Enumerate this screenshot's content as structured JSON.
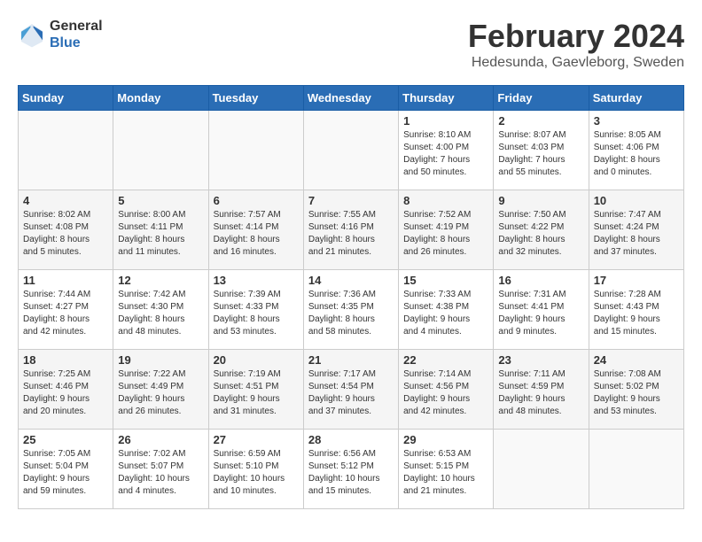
{
  "header": {
    "logo_general": "General",
    "logo_blue": "Blue",
    "title": "February 2024",
    "subtitle": "Hedesunda, Gaevleborg, Sweden"
  },
  "weekdays": [
    "Sunday",
    "Monday",
    "Tuesday",
    "Wednesday",
    "Thursday",
    "Friday",
    "Saturday"
  ],
  "weeks": [
    [
      {
        "day": "",
        "info": ""
      },
      {
        "day": "",
        "info": ""
      },
      {
        "day": "",
        "info": ""
      },
      {
        "day": "",
        "info": ""
      },
      {
        "day": "1",
        "info": "Sunrise: 8:10 AM\nSunset: 4:00 PM\nDaylight: 7 hours\nand 50 minutes."
      },
      {
        "day": "2",
        "info": "Sunrise: 8:07 AM\nSunset: 4:03 PM\nDaylight: 7 hours\nand 55 minutes."
      },
      {
        "day": "3",
        "info": "Sunrise: 8:05 AM\nSunset: 4:06 PM\nDaylight: 8 hours\nand 0 minutes."
      }
    ],
    [
      {
        "day": "4",
        "info": "Sunrise: 8:02 AM\nSunset: 4:08 PM\nDaylight: 8 hours\nand 5 minutes."
      },
      {
        "day": "5",
        "info": "Sunrise: 8:00 AM\nSunset: 4:11 PM\nDaylight: 8 hours\nand 11 minutes."
      },
      {
        "day": "6",
        "info": "Sunrise: 7:57 AM\nSunset: 4:14 PM\nDaylight: 8 hours\nand 16 minutes."
      },
      {
        "day": "7",
        "info": "Sunrise: 7:55 AM\nSunset: 4:16 PM\nDaylight: 8 hours\nand 21 minutes."
      },
      {
        "day": "8",
        "info": "Sunrise: 7:52 AM\nSunset: 4:19 PM\nDaylight: 8 hours\nand 26 minutes."
      },
      {
        "day": "9",
        "info": "Sunrise: 7:50 AM\nSunset: 4:22 PM\nDaylight: 8 hours\nand 32 minutes."
      },
      {
        "day": "10",
        "info": "Sunrise: 7:47 AM\nSunset: 4:24 PM\nDaylight: 8 hours\nand 37 minutes."
      }
    ],
    [
      {
        "day": "11",
        "info": "Sunrise: 7:44 AM\nSunset: 4:27 PM\nDaylight: 8 hours\nand 42 minutes."
      },
      {
        "day": "12",
        "info": "Sunrise: 7:42 AM\nSunset: 4:30 PM\nDaylight: 8 hours\nand 48 minutes."
      },
      {
        "day": "13",
        "info": "Sunrise: 7:39 AM\nSunset: 4:33 PM\nDaylight: 8 hours\nand 53 minutes."
      },
      {
        "day": "14",
        "info": "Sunrise: 7:36 AM\nSunset: 4:35 PM\nDaylight: 8 hours\nand 58 minutes."
      },
      {
        "day": "15",
        "info": "Sunrise: 7:33 AM\nSunset: 4:38 PM\nDaylight: 9 hours\nand 4 minutes."
      },
      {
        "day": "16",
        "info": "Sunrise: 7:31 AM\nSunset: 4:41 PM\nDaylight: 9 hours\nand 9 minutes."
      },
      {
        "day": "17",
        "info": "Sunrise: 7:28 AM\nSunset: 4:43 PM\nDaylight: 9 hours\nand 15 minutes."
      }
    ],
    [
      {
        "day": "18",
        "info": "Sunrise: 7:25 AM\nSunset: 4:46 PM\nDaylight: 9 hours\nand 20 minutes."
      },
      {
        "day": "19",
        "info": "Sunrise: 7:22 AM\nSunset: 4:49 PM\nDaylight: 9 hours\nand 26 minutes."
      },
      {
        "day": "20",
        "info": "Sunrise: 7:19 AM\nSunset: 4:51 PM\nDaylight: 9 hours\nand 31 minutes."
      },
      {
        "day": "21",
        "info": "Sunrise: 7:17 AM\nSunset: 4:54 PM\nDaylight: 9 hours\nand 37 minutes."
      },
      {
        "day": "22",
        "info": "Sunrise: 7:14 AM\nSunset: 4:56 PM\nDaylight: 9 hours\nand 42 minutes."
      },
      {
        "day": "23",
        "info": "Sunrise: 7:11 AM\nSunset: 4:59 PM\nDaylight: 9 hours\nand 48 minutes."
      },
      {
        "day": "24",
        "info": "Sunrise: 7:08 AM\nSunset: 5:02 PM\nDaylight: 9 hours\nand 53 minutes."
      }
    ],
    [
      {
        "day": "25",
        "info": "Sunrise: 7:05 AM\nSunset: 5:04 PM\nDaylight: 9 hours\nand 59 minutes."
      },
      {
        "day": "26",
        "info": "Sunrise: 7:02 AM\nSunset: 5:07 PM\nDaylight: 10 hours\nand 4 minutes."
      },
      {
        "day": "27",
        "info": "Sunrise: 6:59 AM\nSunset: 5:10 PM\nDaylight: 10 hours\nand 10 minutes."
      },
      {
        "day": "28",
        "info": "Sunrise: 6:56 AM\nSunset: 5:12 PM\nDaylight: 10 hours\nand 15 minutes."
      },
      {
        "day": "29",
        "info": "Sunrise: 6:53 AM\nSunset: 5:15 PM\nDaylight: 10 hours\nand 21 minutes."
      },
      {
        "day": "",
        "info": ""
      },
      {
        "day": "",
        "info": ""
      }
    ]
  ]
}
